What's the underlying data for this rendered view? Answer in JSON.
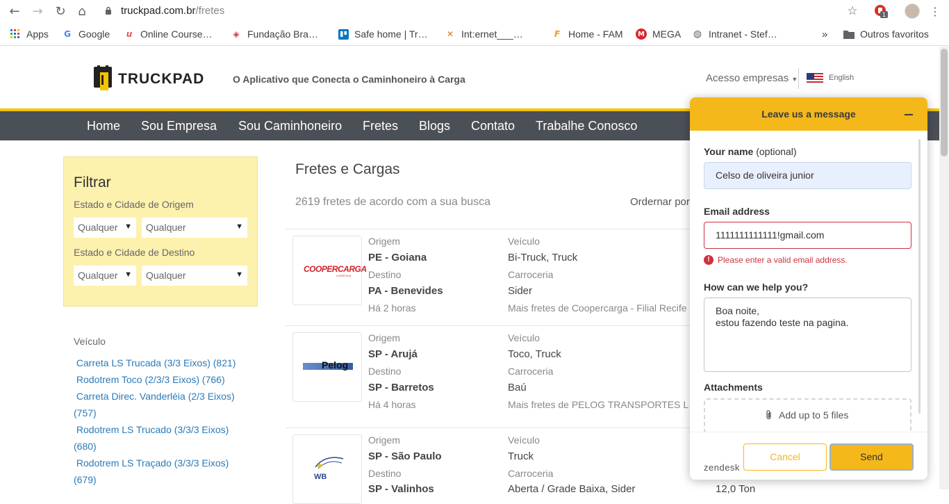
{
  "browser": {
    "url_domain": "truckpad.com.br",
    "url_path": "/fretes",
    "ext_badge": "1",
    "bookmarks": [
      {
        "label": "Apps",
        "icon": "apps-grid-icon"
      },
      {
        "label": "Google",
        "icon": "google-icon"
      },
      {
        "label": "Online Course…",
        "icon": "udemy-icon"
      },
      {
        "label": "Fundação Bra…",
        "icon": "fundacao-icon"
      },
      {
        "label": "Safe home | Tr…",
        "icon": "trello-icon"
      },
      {
        "label": "Int:ernet___…",
        "icon": "internet-icon"
      },
      {
        "label": "Home - FAM",
        "icon": "fam-icon"
      },
      {
        "label": "MEGA",
        "icon": "mega-icon"
      },
      {
        "label": "Intranet - Stef…",
        "icon": "globe-icon"
      }
    ],
    "more": "»",
    "other_bookmarks": "Outros favoritos"
  },
  "header": {
    "logo": "TRUCKPAD",
    "tagline": "O Aplicativo que Conecta o Caminhoneiro à Carga",
    "acesso": "Acesso empresas",
    "language": "English"
  },
  "nav": [
    "Home",
    "Sou Empresa",
    "Sou Caminhoneiro",
    "Fretes",
    "Blogs",
    "Contato",
    "Trabalhe Conosco"
  ],
  "filter": {
    "title": "Filtrar",
    "origin_label": "Estado e Cidade de Origem",
    "dest_label": "Estado e Cidade de Destino",
    "any": "Qualquer"
  },
  "vehicles": {
    "label": "Veículo",
    "items": [
      "Carreta LS Trucada (3/3 Eixos) (821)",
      "Rodotrem Toco (2/3/3 Eixos) (766)",
      "Carreta Direc. Vanderléia (2/3 Eixos) (757)",
      "Rodotrem LS Trucado (3/3/3 Eixos) (680)",
      "Rodotrem LS Traçado (3/3/3 Eixos) (679)"
    ]
  },
  "results": {
    "title": "Fretes e Cargas",
    "count": "2619 fretes de acordo com a sua busca",
    "order": "Ordernar por",
    "labels": {
      "origem": "Origem",
      "destino": "Destino",
      "veiculo": "Veículo",
      "carroceria": "Carroceria"
    },
    "items": [
      {
        "logo": "COOPERCARGA",
        "logo_sub": "LOGÍSTICA",
        "origin": "PE - Goiana",
        "dest": "PA - Benevides",
        "time": "Há 2 horas",
        "vehicle": "Bi-Truck, Truck",
        "body": "Sider",
        "more": "Mais fretes de Coopercarga - Filial Recife"
      },
      {
        "logo": "Pelog",
        "origin": "SP - Arujá",
        "dest": "SP - Barretos",
        "time": "Há 4 horas",
        "vehicle": "Toco, Truck",
        "body": "Baú",
        "more": "Mais fretes de PELOG TRANSPORTES L"
      },
      {
        "logo": "WB",
        "origin": "SP - São Paulo",
        "dest": "SP - Valinhos",
        "vehicle": "Truck",
        "body": "Aberta / Grade Baixa, Sider",
        "weight": "12,0 Ton"
      }
    ]
  },
  "widget": {
    "title": "Leave us a message",
    "name_label": "Your name",
    "optional": "(optional)",
    "name_value": "Celso de oliveira junior",
    "email_label": "Email address",
    "email_value": "1111111111111!gmail.com",
    "email_error": "Please enter a valid email address.",
    "help_label": "How can we help you?",
    "help_line1": "Boa noite,",
    "help_line2": "estou fazendo teste na pagina.",
    "attach_label": "Attachments",
    "attach_text": "Add up to 5 files",
    "brand": "zendesk",
    "cancel": "Cancel",
    "send": "Send",
    "colors": {
      "accent": "#f4b81b",
      "error": "#cc3340",
      "input_bg": "#e8f0fe"
    }
  }
}
